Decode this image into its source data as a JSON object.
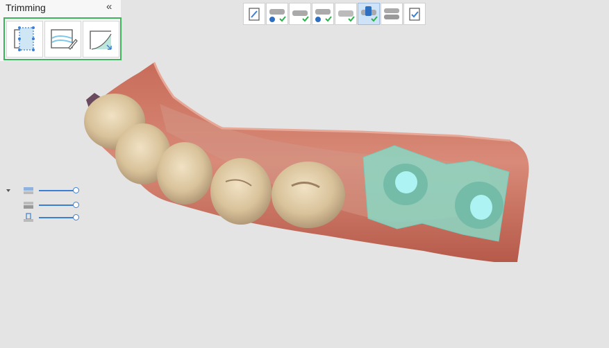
{
  "panel": {
    "title": "Trimming",
    "collapse_glyph": "«",
    "tools": [
      {
        "icon": "lasso-trim-icon"
      },
      {
        "icon": "smooth-trim-icon"
      },
      {
        "icon": "plane-cut-icon"
      }
    ]
  },
  "stages": [
    {
      "icon": "notes-icon",
      "state": "none"
    },
    {
      "icon": "upper-jaw-scan-icon",
      "state": "complete"
    },
    {
      "icon": "lower-jaw-scan-icon",
      "state": "complete"
    },
    {
      "icon": "pre-op-scan-icon",
      "state": "complete"
    },
    {
      "icon": "occlusion-scan-icon",
      "state": "complete"
    },
    {
      "icon": "scan-body-icon",
      "state": "active-complete"
    },
    {
      "icon": "alignment-icon",
      "state": "none"
    },
    {
      "icon": "review-icon",
      "state": "none"
    }
  ],
  "side_controls": [
    {
      "icon": "layer-upper-icon",
      "level": 1.0
    },
    {
      "icon": "layer-lower-icon",
      "level": 1.0
    },
    {
      "icon": "scan-body-layer-icon",
      "level": 1.0
    }
  ],
  "colors": {
    "accent": "#3a7fd4",
    "panel_highlight": "#3cb55a",
    "check": "#2bb24c",
    "gum": "#c87060",
    "tooth": "#d9c5a0",
    "selection": "#8ad8c4"
  }
}
